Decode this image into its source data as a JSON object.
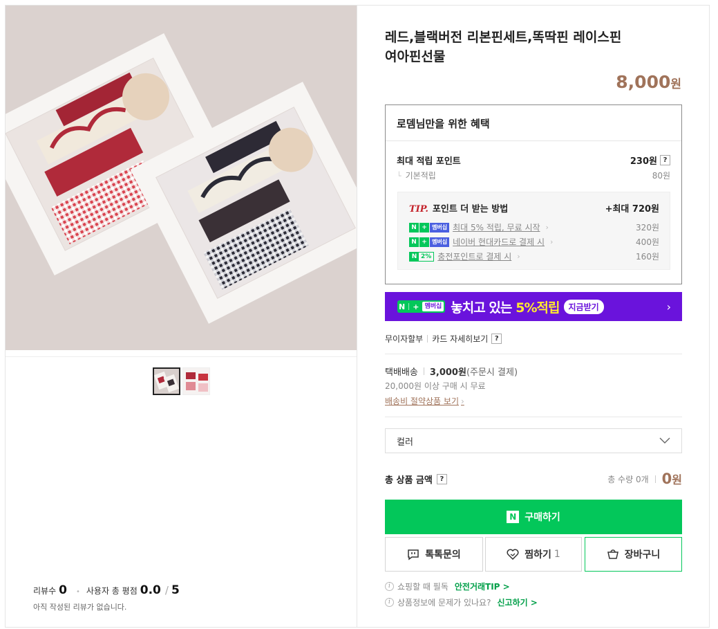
{
  "product": {
    "title_line1": "레드,블랙버전 리본핀세트,똑딱핀 레이스핀",
    "title_line2": "여아핀선물",
    "price": "8,000",
    "price_unit": "원"
  },
  "benefit": {
    "heading": "로뎀님만을 위한 혜택",
    "max_points_label": "최대 적립 포인트",
    "max_points_value": "230원",
    "base_label": "기본적립",
    "base_value": "80원",
    "tip_label": "TIP.",
    "tip_title": "포인트 더 받는 방법",
    "tip_max": "+최대 720원",
    "tips": [
      {
        "badge": "멤버십",
        "text": "최대 5% 적립, 무료 시작",
        "value": "320원"
      },
      {
        "badge": "멤버십",
        "text": "네이버 현대카드로 결제 시",
        "value": "400원"
      },
      {
        "badge": "2%",
        "text": "충전포인트로 결제 시",
        "value": "160원"
      }
    ]
  },
  "banner": {
    "badge_n": "N",
    "badge_plus": "+",
    "badge_mem": "멤버십",
    "text": "놓치고 있는",
    "highlight": "5%적립",
    "button": "지금받기"
  },
  "card": {
    "interest_free": "무이자할부",
    "card_detail": "카드 자세히보기"
  },
  "shipping": {
    "type": "택배배송",
    "fee": "3,000원",
    "fee_note": "(주문시 결제)",
    "free_condition": "20,000원 이상 구매 시 무료",
    "save_link": "배송비 절약상품 보기"
  },
  "option": {
    "placeholder": "컬러"
  },
  "total": {
    "label": "총 상품 금액",
    "qty": "총 수량 0개",
    "amount": "0",
    "unit": "원"
  },
  "buttons": {
    "buy": "구매하기",
    "talk": "톡톡문의",
    "wish": "찜하기",
    "wish_count": "1",
    "cart": "장바구니"
  },
  "notices": {
    "safe_prefix": "쇼핑할 때 필독",
    "safe_link": "안전거래TIP >",
    "report_prefix": "상품정보에 문제가 있나요?",
    "report_link": "신고하기 >"
  },
  "reviews": {
    "count_label": "리뷰수",
    "count": "0",
    "rating_label": "사용자 총 평점",
    "rating": "0.0",
    "rating_max": "5",
    "empty": "아직 작성된 리뷰가 없습니다."
  },
  "colors": {
    "naver_green": "#03c75a",
    "price_brown": "#a0735a",
    "banner_purple": "#6a13dc",
    "tip_red": "#c4232b"
  }
}
